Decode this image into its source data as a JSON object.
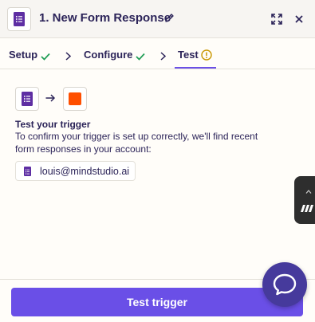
{
  "header": {
    "title": "1. New Form Response",
    "app_icon": "google-forms-icon",
    "actions": [
      "pencil-icon",
      "expand-icon",
      "close-icon"
    ]
  },
  "steps": [
    {
      "label": "Setup",
      "status": "complete"
    },
    {
      "label": "Configure",
      "status": "complete"
    },
    {
      "label": "Test",
      "status": "warning",
      "active": true
    }
  ],
  "flow": {
    "from_icon": "google-forms-icon",
    "to_icon": "zapier-icon"
  },
  "content": {
    "heading": "Test your trigger",
    "description": "To confirm your trigger is set up correctly, we'll find recent form responses in your account:",
    "account": "louis@mindstudio.ai"
  },
  "footer": {
    "button_label": "Test trigger"
  },
  "colors": {
    "accent": "#6a4fe7",
    "check": "#1f9d55",
    "warning": "#c99700",
    "forms_purple": "#5e2ea3",
    "zapier_orange": "#ff4f00"
  }
}
